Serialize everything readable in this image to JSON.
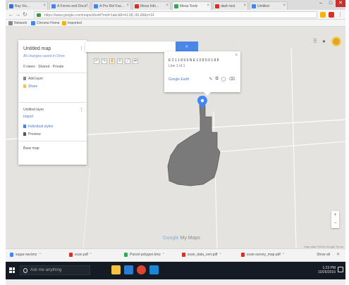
{
  "browser": {
    "tabs": [
      {
        "label": "Bay Vis...",
        "color": "#3b6fd1"
      },
      {
        "label": "A Forms and Docs...",
        "color": "#4285f4"
      },
      {
        "label": "A Pro Ref Fac...",
        "color": "#4285f4"
      },
      {
        "label": "Mesa Info...",
        "color": "#d93025"
      },
      {
        "label": "Mesa Tools",
        "color": "#34a853"
      },
      {
        "label": "dash test",
        "color": "#d93025"
      },
      {
        "label": "Untitled",
        "color": "#4285f4"
      }
    ],
    "window_buttons": [
      "–",
      "□",
      "✕"
    ],
    "url": "https://www.google.com/maps/d/edit?mid=1abc&ll=41.58,-90.68&z=14",
    "bookmarks": [
      {
        "label": "Network",
        "color": "#888888"
      },
      {
        "label": "Chrome Home",
        "color": "#4285f4"
      },
      {
        "label": "Imported",
        "color": "#f4b400"
      }
    ]
  },
  "map": {
    "side_panel": {
      "title": "Untitled map",
      "last_edited": "All changes saved in Drive",
      "views": "0 views · Shared · Private",
      "add_layer": "Add layer",
      "share": "Share",
      "preview": "Preview",
      "layer_name": "Untitled layer",
      "import": "Import",
      "style": "Individual styles",
      "base_map": "Base map"
    },
    "search_placeholder": "",
    "search_icon": "search-icon",
    "infowindow": {
      "line1": "E 2 1 1 8 9 6 N E 1 0 8 5 0 1 8 8",
      "line2": "Line 1 of 1",
      "link": "Google Earth",
      "buttons": [
        "✎",
        "⧉",
        "◯",
        "⌫"
      ]
    },
    "polygon_color": "#7a7a7a",
    "logo_google": "Google",
    "logo_suffix": "My Maps",
    "scale_text": "Map data ©2016 Google  Terms"
  },
  "downloads": {
    "items": [
      {
        "label": "sugar-sw.kmz",
        "color": "#4285f4"
      },
      {
        "label": "scan.pdf",
        "color": "#d93025"
      },
      {
        "label": "Parcel-polygon.kmz",
        "color": "#34a853"
      },
      {
        "label": "scan_data_cert.pdf",
        "color": "#d93025"
      },
      {
        "label": "scan-survey_map.pdf",
        "color": "#d93025"
      }
    ],
    "show_all": "Show all",
    "close": "✕"
  },
  "taskbar": {
    "search_text": "Ask me anything",
    "apps": [
      {
        "name": "file-explorer-icon",
        "color": "#f5c242"
      },
      {
        "name": "edge-icon",
        "color": "#2b7cd3"
      },
      {
        "name": "chrome-icon",
        "color": "#db4437"
      },
      {
        "name": "store-icon",
        "color": "#1a86d8"
      }
    ],
    "time": "1:23 PM",
    "date": "10/26/2016"
  }
}
